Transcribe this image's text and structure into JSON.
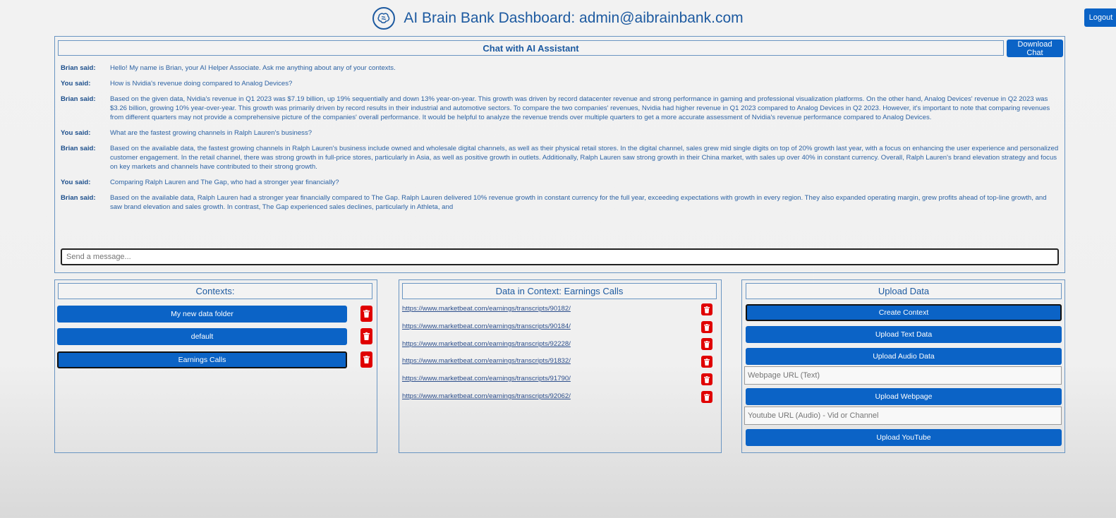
{
  "header": {
    "title": "AI Brain Bank Dashboard: admin@aibrainbank.com",
    "logo_icon": "brain-icon"
  },
  "logout_label": "Logout",
  "chat": {
    "title": "Chat with AI Assistant",
    "download_label": "Download Chat",
    "messages": [
      {
        "who": "Brian said:",
        "text": "Hello! My name is Brian, your AI Helper Associate. Ask me anything about any of your contexts."
      },
      {
        "who": "You said:",
        "text": "How is Nvidia's revenue doing compared to Analog Devices?"
      },
      {
        "who": "Brian said:",
        "text": "Based on the given data, Nvidia's revenue in Q1 2023 was $7.19 billion, up 19% sequentially and down 13% year-on-year. This growth was driven by record datacenter revenue and strong performance in gaming and professional visualization platforms. On the other hand, Analog Devices' revenue in Q2 2023 was $3.26 billion, growing 10% year-over-year. This growth was primarily driven by record results in their industrial and automotive sectors. To compare the two companies' revenues, Nvidia had higher revenue in Q1 2023 compared to Analog Devices in Q2 2023. However, it's important to note that comparing revenues from different quarters may not provide a comprehensive picture of the companies' overall performance. It would be helpful to analyze the revenue trends over multiple quarters to get a more accurate assessment of Nvidia's revenue performance compared to Analog Devices."
      },
      {
        "who": "You said:",
        "text": "What are the fastest growing channels in Ralph Lauren's business?"
      },
      {
        "who": "Brian said:",
        "text": "Based on the available data, the fastest growing channels in Ralph Lauren's business include owned and wholesale digital channels, as well as their physical retail stores. In the digital channel, sales grew mid single digits on top of 20% growth last year, with a focus on enhancing the user experience and personalized customer engagement. In the retail channel, there was strong growth in full-price stores, particularly in Asia, as well as positive growth in outlets. Additionally, Ralph Lauren saw strong growth in their China market, with sales up over 40% in constant currency. Overall, Ralph Lauren's brand elevation strategy and focus on key markets and channels have contributed to their strong growth."
      },
      {
        "who": "You said:",
        "text": "Comparing Ralph Lauren and The Gap, who had a stronger year financially?"
      },
      {
        "who": "Brian said:",
        "text": "Based on the available data, Ralph Lauren had a stronger year financially compared to The Gap. Ralph Lauren delivered 10% revenue growth in constant currency for the full year, exceeding expectations with growth in every region. They also expanded operating margin, grew profits ahead of top-line growth, and saw brand elevation and sales growth. In contrast, The Gap experienced sales declines, particularly in Athleta, and"
      }
    ],
    "input_placeholder": "Send a message..."
  },
  "contexts": {
    "title": "Contexts:",
    "items": [
      {
        "label": "My new data folder"
      },
      {
        "label": "default"
      },
      {
        "label": "Earnings Calls"
      }
    ]
  },
  "data_in_context": {
    "title": "Data in Context: Earnings Calls",
    "links": [
      "https://www.marketbeat.com/earnings/transcripts/90182/",
      "https://www.marketbeat.com/earnings/transcripts/90184/",
      "https://www.marketbeat.com/earnings/transcripts/92228/",
      "https://www.marketbeat.com/earnings/transcripts/91832/",
      "https://www.marketbeat.com/earnings/transcripts/91790/",
      "https://www.marketbeat.com/earnings/transcripts/92062/"
    ]
  },
  "upload": {
    "title": "Upload Data",
    "create_context": "Create Context",
    "upload_text": "Upload Text Data",
    "upload_audio": "Upload Audio Data",
    "webpage_placeholder": "Webpage URL (Text)",
    "upload_webpage": "Upload Webpage",
    "youtube_placeholder": "Youtube URL (Audio) - Vid or Channel",
    "upload_youtube": "Upload YouTube"
  },
  "colors": {
    "accent": "#0b63c6",
    "delete": "#e00000",
    "border": "#6a95c2"
  }
}
